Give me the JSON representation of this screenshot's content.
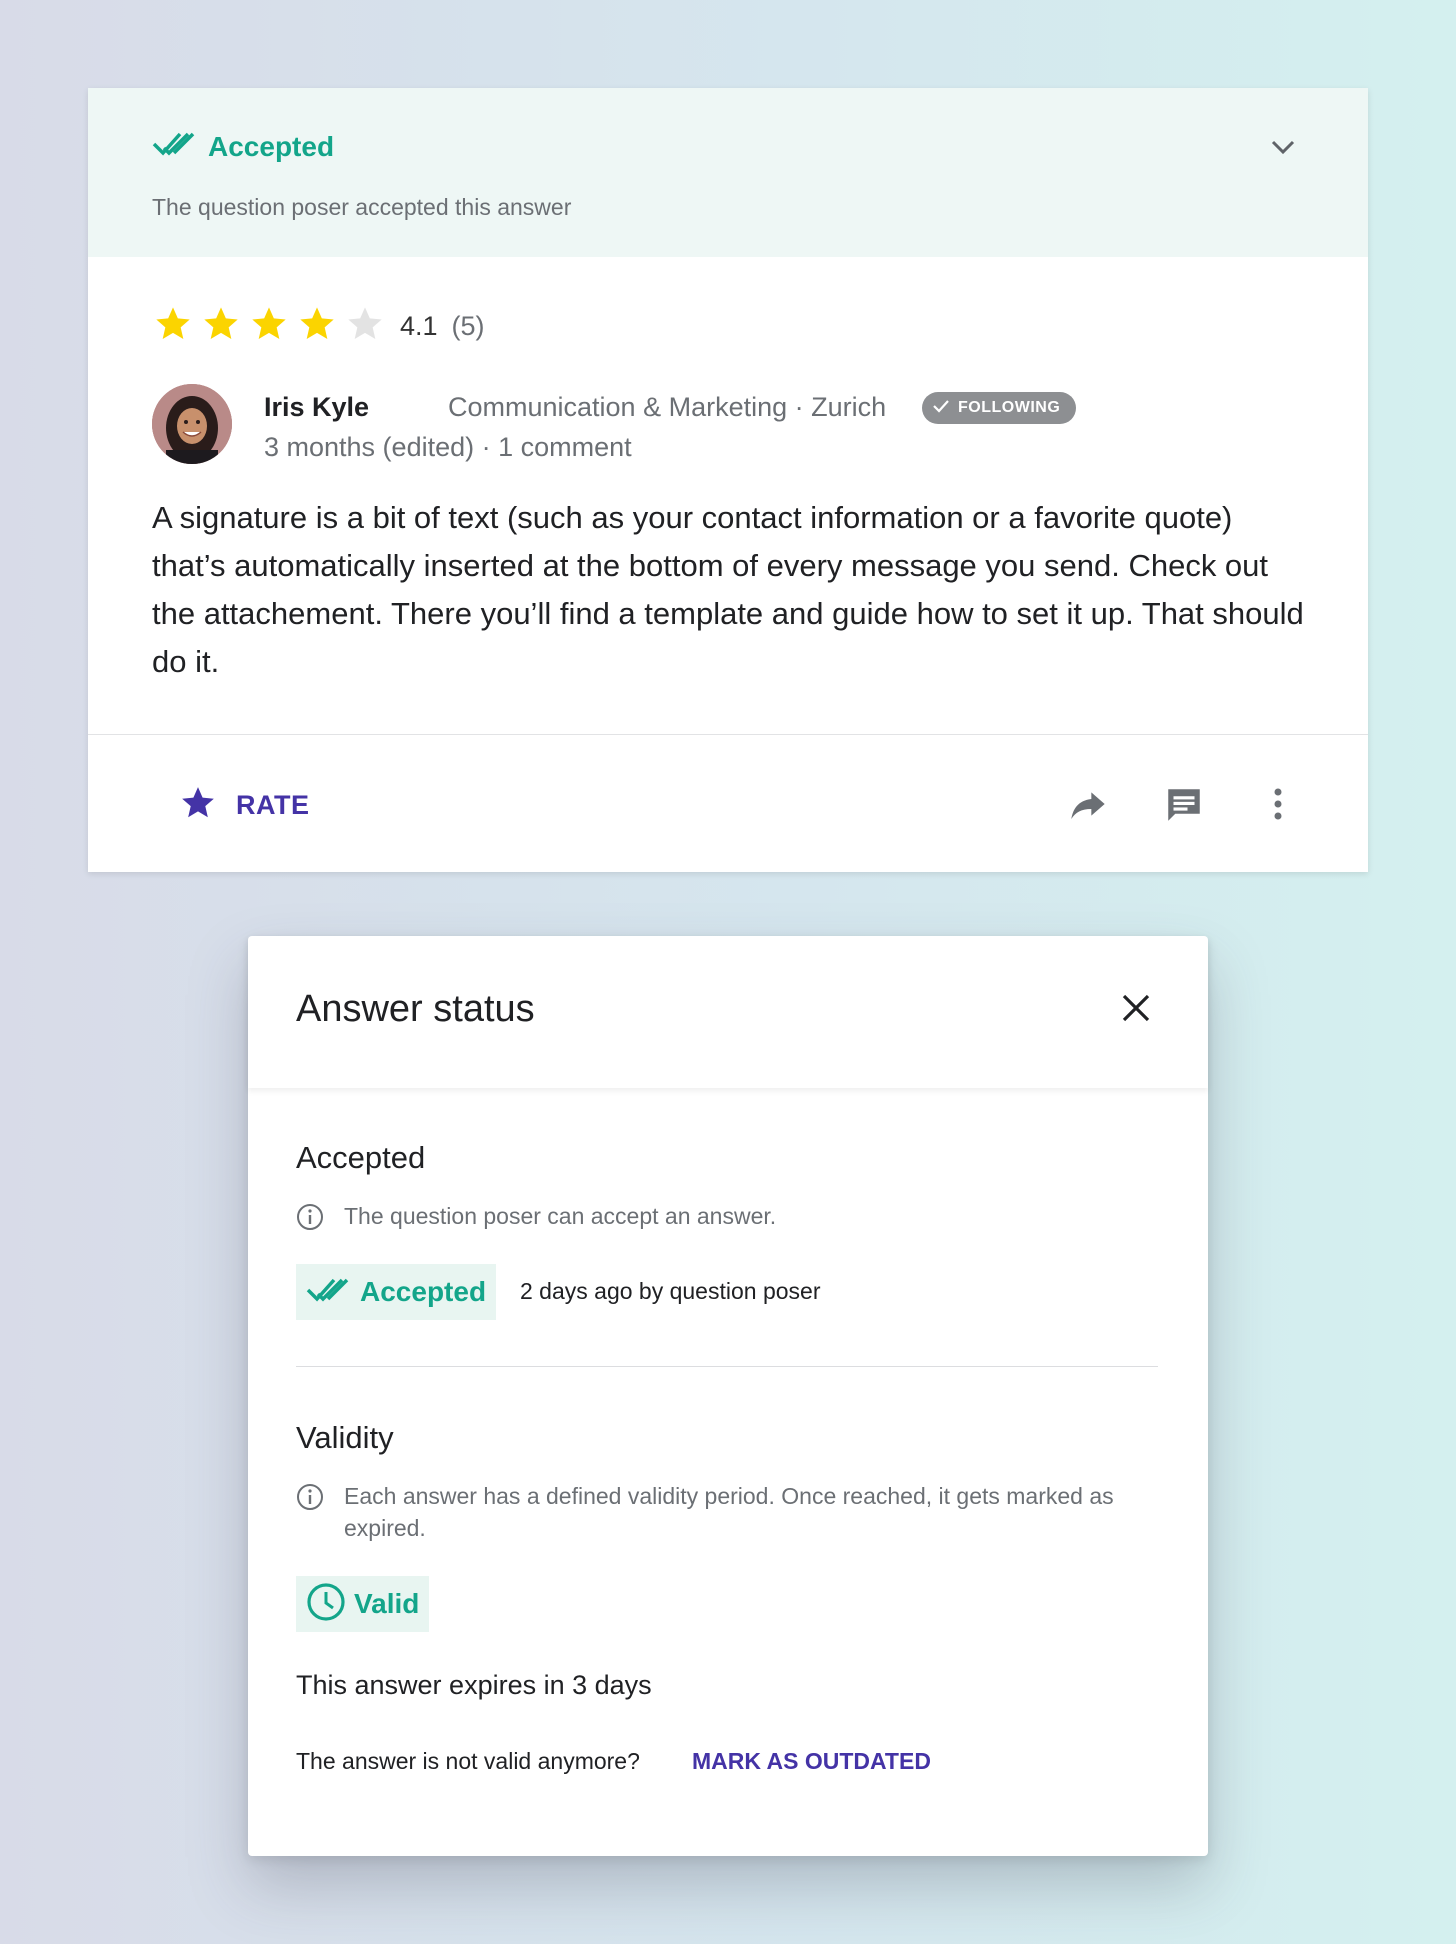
{
  "answer_card": {
    "banner": {
      "status_label": "Accepted",
      "subtitle": "The question poser accepted this answer"
    },
    "rating": {
      "stars_filled": 4,
      "stars_total": 5,
      "value": "4.1",
      "count": "(5)"
    },
    "author": {
      "name": "Iris Kyle",
      "meta": "Communication & Marketing · Zurich",
      "badge": "FOLLOWING",
      "time": "3 months (edited) · 1 comment"
    },
    "body": "A signature is a bit of text (such as your contact information or a favorite quote) that’s automatically inserted at the bottom of every message you send. Check out the attachement. There you’ll find a template and guide how to set it up. That should do it.",
    "actions": {
      "rate_label": "RATE"
    }
  },
  "dialog": {
    "title": "Answer status",
    "accepted": {
      "heading": "Accepted",
      "info": "The question poser can accept an answer.",
      "chip_label": "Accepted",
      "detail": "2 days ago by question poser"
    },
    "validity": {
      "heading": "Validity",
      "info": "Each answer has a defined validity period. Once reached, it gets marked as expired.",
      "chip_label": "Valid",
      "expires": "This answer expires in 3 days",
      "question": "The answer is not valid anymore?",
      "action": "MARK AS OUTDATED"
    }
  },
  "colors": {
    "accent_green": "#13a58a",
    "accent_purple": "#4433a6",
    "star_yellow": "#fbd400"
  }
}
